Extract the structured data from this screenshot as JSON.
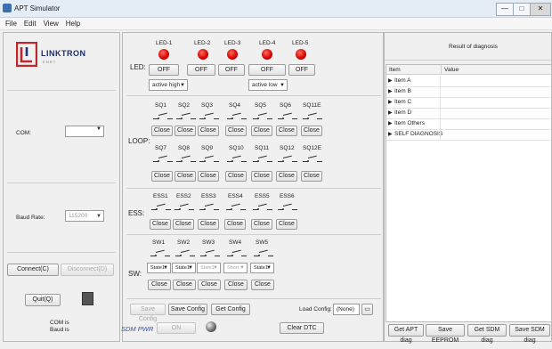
{
  "window": {
    "title": "APT Simulator",
    "controls": [
      "—",
      "□",
      "✕"
    ]
  },
  "menu": [
    "File",
    "Edit",
    "View",
    "Help"
  ],
  "logo": {
    "text": "LINKTRON",
    "sub": "E  N  R  T"
  },
  "left": {
    "com_label": "COM:",
    "com_value": "",
    "baud_label": "Baud Rate:",
    "baud_value": "115200",
    "connect": "Connect(C)",
    "disconnect": "Disconnect(D)",
    "quit": "Quit(Q)",
    "status_line1": "COM is",
    "status_line2": "Baud is"
  },
  "led": {
    "label": "LED:",
    "names": [
      "LED-1",
      "LED-2",
      "LED-3",
      "LED-4",
      "LED-5"
    ],
    "buttons": [
      "OFF",
      "OFF",
      "OFF",
      "OFF",
      "OFF"
    ],
    "mode_left": "active high",
    "mode_right": "active low"
  },
  "loop": {
    "label": "LOOP:",
    "row1": [
      "SQ1",
      "SQ2",
      "SQ3",
      "SQ4",
      "SQ5",
      "SQ6",
      "SQ11E"
    ],
    "row2": [
      "SQ7",
      "SQ8",
      "SQ9",
      "SQ10",
      "SQ11",
      "SQ12",
      "SQ12E"
    ],
    "close": "Close"
  },
  "ess": {
    "label": "ESS:",
    "names": [
      "ESS1",
      "ESS2",
      "ESS3",
      "ESS4",
      "ESS5",
      "ESS6"
    ],
    "close": "Close"
  },
  "sw": {
    "label": "SW:",
    "names": [
      "SW1",
      "SW2",
      "SW3",
      "SW4",
      "SW5"
    ],
    "states": [
      "State1",
      "State1",
      "State1",
      "Short",
      "State1"
    ],
    "close": "Close"
  },
  "config": {
    "save_config_disabled": "Save Config",
    "save_config": "Save Config",
    "get_config": "Get Config",
    "load_label": "Load Config:",
    "load_value": "(None)"
  },
  "footer": {
    "sdm_pwr": "SDM PWR",
    "on": "ON",
    "clear_dtc": "Clear DTC"
  },
  "result": {
    "title": "Result of diagnosis",
    "columns": [
      "Item",
      "Value"
    ],
    "rows": [
      "Item A",
      "Item B",
      "Item C",
      "Item D",
      "Item Others",
      "SELF DIAGNOSIS"
    ]
  },
  "actions": [
    "Get APT diag",
    "Save EEPROM",
    "Get SDM diag",
    "Save SDM diag"
  ]
}
